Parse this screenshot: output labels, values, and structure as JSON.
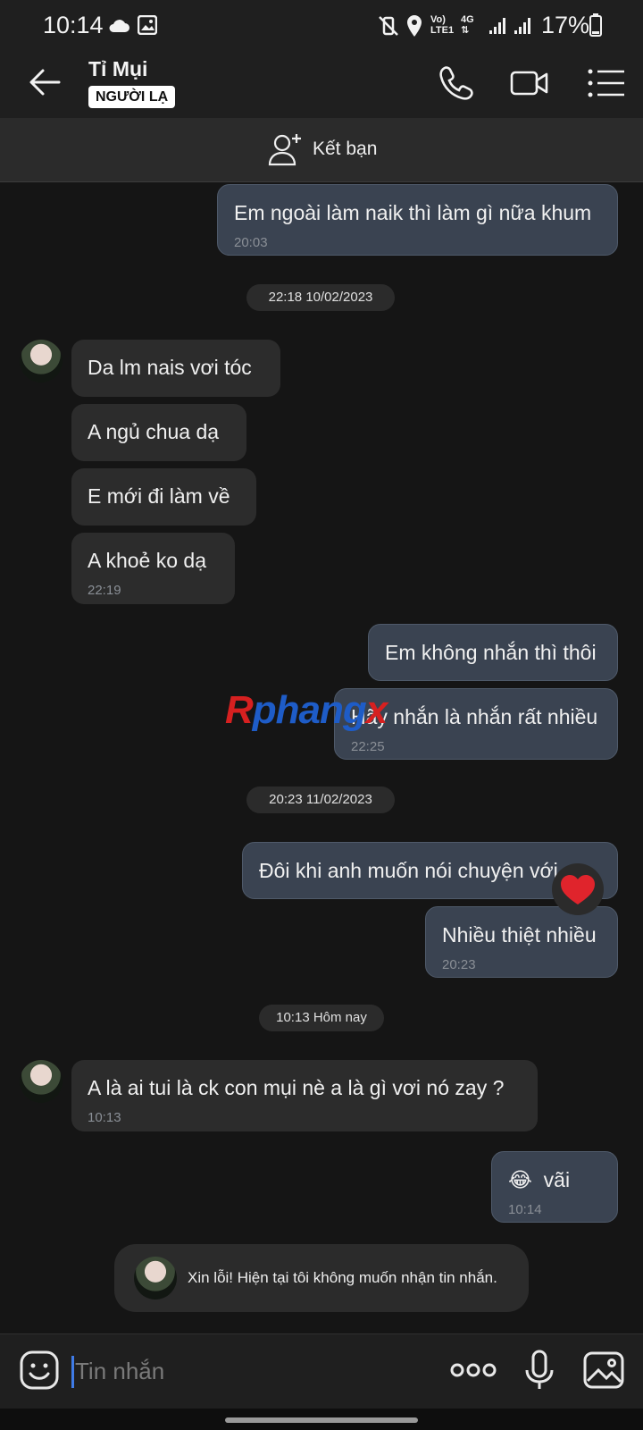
{
  "status_bar": {
    "time": "10:14",
    "battery": "17%",
    "icons": [
      "cloud-icon",
      "image-icon",
      "mute-vibrate-icon",
      "location-icon",
      "volte-icon",
      "4g-icon",
      "signal-icon",
      "signal-icon",
      "battery-icon"
    ],
    "volte_label": "Vo)",
    "lte_label": "LTE1",
    "network_label": "4G"
  },
  "header": {
    "contact_name": "Tỉ Mụi",
    "badge": "NGƯỜI LẠ"
  },
  "add_friend": {
    "label": "Kết bạn"
  },
  "messages": [
    {
      "dir": "out",
      "text": "Em ngoài làm naik thì làm gì nữa khum",
      "time": "20:03"
    },
    {
      "date": "22:18 10/02/2023"
    },
    {
      "dir": "in",
      "text": "Da lm nais vơi tóc"
    },
    {
      "dir": "in",
      "text": "A ngủ chua dạ"
    },
    {
      "dir": "in",
      "text": "E mới đi làm về"
    },
    {
      "dir": "in",
      "text": "A khoẻ ko dạ",
      "time": "22:19"
    },
    {
      "dir": "out",
      "text": "Em không nhắn thì thôi"
    },
    {
      "dir": "out",
      "text": "Hãy nhắn là nhắn rất nhiều",
      "time": "22:25"
    },
    {
      "date": "20:23 11/02/2023"
    },
    {
      "dir": "out",
      "text": "Đôi khi anh muốn nói chuyện với em"
    },
    {
      "dir": "out",
      "text": "Nhiều thiệt nhiều",
      "time": "20:23"
    },
    {
      "date": "10:13 Hôm nay"
    },
    {
      "dir": "in",
      "text": "A là ai tui là ck con mụi nè a là gì vơi nó zay ?",
      "time": "10:13"
    },
    {
      "dir": "out",
      "text": "vãi",
      "time": "10:14",
      "emoji": "😂"
    }
  ],
  "watermark": {
    "r": "R",
    "rest": "phang",
    "x": "x"
  },
  "system_note": "Xin lỗi! Hiện tại tôi không muốn nhận tin nhắn.",
  "input": {
    "placeholder": "Tin nhắn"
  },
  "colors": {
    "background": "#151515",
    "incoming_bubble": "#2c2c2c",
    "outgoing_bubble": "#3a4351",
    "caret": "#3f7be6"
  }
}
